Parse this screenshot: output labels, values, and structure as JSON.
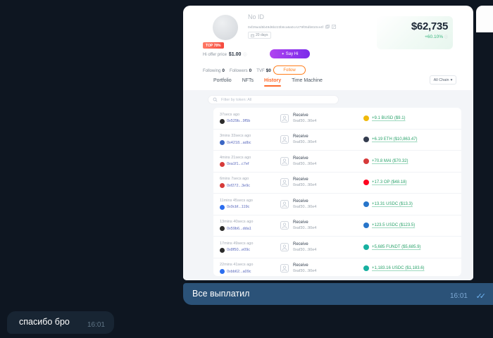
{
  "screenshot": {
    "profile": {
      "name": "No ID",
      "address": "0xf29a4d5b49d6b223b6ca6a0cA279f05db810ce4f",
      "age_badge": "20 days",
      "rank_badge": "TOP 78%",
      "balance": "$62,735",
      "change": "+60.10%",
      "offer_label": "Hi offer price",
      "offer_value": "$1.00",
      "say_hi_label": "Say Hi",
      "follow_label": "Follow",
      "stats": [
        {
          "label": "Following",
          "value": "0"
        },
        {
          "label": "Followers",
          "value": "0"
        },
        {
          "label": "TVF",
          "value": "$0"
        }
      ]
    },
    "tabs": {
      "items": [
        {
          "label": "Portfolio"
        },
        {
          "label": "NFTs"
        },
        {
          "label": "History"
        },
        {
          "label": "Time Machine"
        }
      ],
      "active": "History"
    },
    "chain_filter": {
      "label": "All Chain",
      "caret": "▾"
    },
    "history": {
      "filter_placeholder": "Filter by token: All",
      "rows": [
        {
          "time": "37secs ago",
          "tx": "0x529b...9f5b",
          "chain_color": "#2c2c2c",
          "action": "Receive",
          "from": "0xaf30...90e4",
          "amount": "+9.1 BUSD ($9.1)",
          "token_color": "#f0b90b"
        },
        {
          "time": "3mins 33secs ago",
          "tx": "0x4218...adbc",
          "chain_color": "#3b66c4",
          "action": "Receive",
          "from": "0xaf30...90e4",
          "amount": "+6.19 ETH ($10,863.47)",
          "token_color": "#343c4e"
        },
        {
          "time": "4mins 21secs ago",
          "tx": "0xa1f1...c7ef",
          "chain_color": "#d63a3a",
          "action": "Receive",
          "from": "0xaf30...90e4",
          "amount": "+70.8 MAI ($70.32)",
          "token_color": "#d63a3a"
        },
        {
          "time": "6mins 7secs ago",
          "tx": "0xf272...3e9c",
          "chain_color": "#d63a3a",
          "action": "Receive",
          "from": "0xaf30...90e4",
          "amount": "+17.3 OP ($48.18)",
          "token_color": "#ff0420"
        },
        {
          "time": "11mins 45secs ago",
          "tx": "0x9cbf...119c",
          "chain_color": "#2b6def",
          "action": "Receive",
          "from": "0xaf30...90e4",
          "amount": "+13.31 USDC ($13.3)",
          "token_color": "#2775ca"
        },
        {
          "time": "13mins 40secs ago",
          "tx": "0x59b6...dda1",
          "chain_color": "#2c2c2c",
          "action": "Receive",
          "from": "0xaf30...90e4",
          "amount": "+123.5 USDC ($123.5)",
          "token_color": "#2775ca"
        },
        {
          "time": "17mins 49secs ago",
          "tx": "0x8f50...e09c",
          "chain_color": "#2c2c2c",
          "action": "Receive",
          "from": "0xaf30...90e4",
          "amount": "+5,685 FUNDT ($5,685.9)",
          "token_color": "#17b0a0"
        },
        {
          "time": "22mins 41secs ago",
          "tx": "0xbb62...a09c",
          "chain_color": "#2b6def",
          "action": "Receive",
          "from": "0xaf30...90e4",
          "amount": "+1,183.16 USDC ($1,183.6)",
          "token_color": "#17b0a0"
        }
      ]
    }
  },
  "messages": {
    "outgoing": {
      "text": "Все выплатил",
      "time": "16:01",
      "status": "✓✓"
    },
    "incoming": {
      "text": "спасибо бро",
      "time": "16:01"
    }
  },
  "icons": {
    "info": "ⓘ",
    "sparkle": "✦"
  },
  "colors": {
    "background": "#0e1621",
    "outgoing_bubble": "#2b5278",
    "incoming_bubble": "#182533",
    "accent_orange": "#ff6b2c",
    "positive_green": "#2aa36b",
    "balance_text": "#1c2736"
  }
}
